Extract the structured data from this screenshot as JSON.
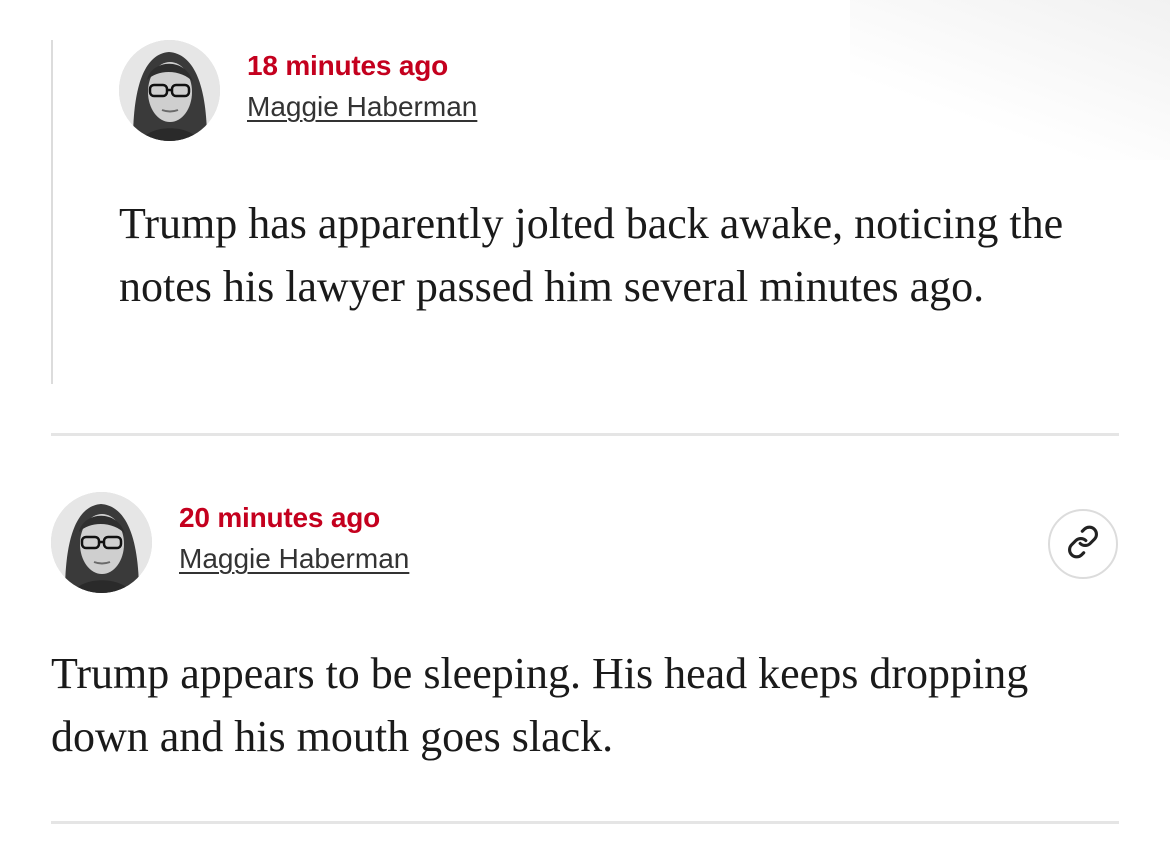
{
  "posts": [
    {
      "timestamp": "18 minutes ago",
      "author": "Maggie Haberman",
      "body": "Trump has apparently jolted back awake, noticing the notes his lawyer passed him several minutes ago."
    },
    {
      "timestamp": "20 minutes ago",
      "author": "Maggie Haberman",
      "body": "Trump appears to be sleeping. His head keeps dropping down and his mouth goes slack.",
      "link_icon": "link-icon"
    }
  ],
  "colors": {
    "timestamp": "#c4001e",
    "byline": "#333333",
    "divider": "#e5e5e5"
  }
}
